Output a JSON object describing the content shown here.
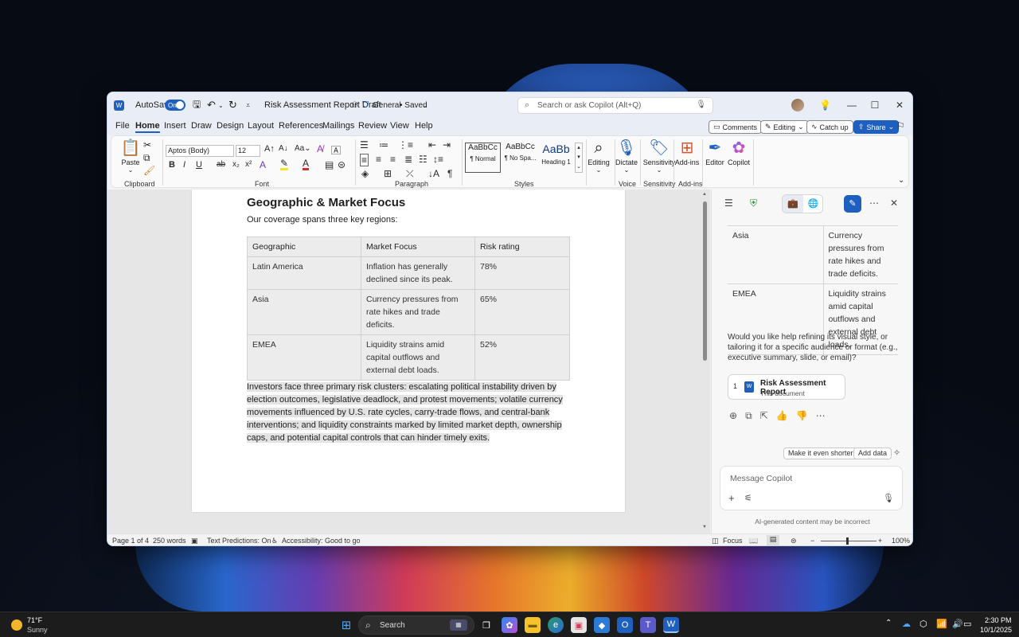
{
  "window": {
    "autosave_label": "AutoSave",
    "autosave_state": "On",
    "doc_title": "Risk Assessment Report Draft",
    "sensitivity": "General",
    "saved_state": "• Saved",
    "search_placeholder": "Search or ask Copilot (Alt+Q)"
  },
  "menu": {
    "items": [
      "File",
      "Home",
      "Insert",
      "Draw",
      "Design",
      "Layout",
      "References",
      "Mailings",
      "Review",
      "View",
      "Help"
    ],
    "active": "Home",
    "comments_label": "Comments",
    "editing_label": "Editing",
    "catchup_label": "Catch up",
    "share_label": "Share"
  },
  "ribbon": {
    "paste_label": "Paste",
    "font_name": "Aptos (Body)",
    "font_size": "12",
    "styles": [
      {
        "preview": "AaBbCc",
        "name": "¶ Normal"
      },
      {
        "preview": "AaBbCc",
        "name": "¶ No Spa..."
      },
      {
        "preview": "AaBb",
        "name": "Heading 1"
      }
    ],
    "buttons": {
      "editing": "Editing",
      "dictate": "Dictate",
      "sensitivity": "Sensitivity",
      "addins": "Add-ins",
      "editor": "Editor",
      "copilot": "Copilot"
    },
    "groups": {
      "clipboard": "Clipboard",
      "font": "Font",
      "paragraph": "Paragraph",
      "styles": "Styles",
      "voice": "Voice",
      "sensitivity": "Sensitivity",
      "addins": "Add-ins"
    }
  },
  "document": {
    "heading": "Geographic & Market Focus",
    "intro": "Our coverage spans three key regions:",
    "table": {
      "headers": [
        "Geographic",
        "Market Focus",
        "Risk rating"
      ],
      "rows": [
        [
          "Latin America",
          "Inflation has generally declined since its peak.",
          "78%"
        ],
        [
          "Asia",
          "Currency pressures from rate hikes and trade deficits.",
          "65%"
        ],
        [
          "EMEA",
          "Liquidity strains amid capital outflows and external debt loads.",
          "52%"
        ]
      ]
    },
    "paragraph": "Investors face three primary risk clusters: escalating political instability driven by election outcomes, legislative deadlock, and protest movements; volatile currency movements influenced by U.S. rate cycles, carry-trade flows, and central-bank interventions; and liquidity constraints marked by limited market depth, ownership caps, and potential capital controls that can hinder timely exits."
  },
  "copilot": {
    "table_rows": [
      [
        "Asia",
        "Currency pressures from rate hikes and trade deficits."
      ],
      [
        "EMEA",
        "Liquidity strains amid capital outflows and external debt loads."
      ]
    ],
    "message": "Would you like help refining its visual style, or tailoring it for a specific audience or format (e.g., executive summary, slide, or email)?",
    "ref_number": "1",
    "ref_title": "Risk Assessment Report",
    "ref_sub": "This document",
    "chip1": "Make it even shorter",
    "chip2": "Add data",
    "input_placeholder": "Message Copilot",
    "footer": "AI-generated content may be incorrect"
  },
  "status": {
    "page": "Page 1 of 4",
    "words": "250 words",
    "predictions": "Text Predictions: On",
    "accessibility": "Accessibility: Good to go",
    "focus": "Focus",
    "zoom": "100%"
  },
  "taskbar": {
    "weather_temp": "71°F",
    "weather_desc": "Sunny",
    "search_label": "Search",
    "time": "2:30 PM",
    "date": "10/1/2025"
  }
}
